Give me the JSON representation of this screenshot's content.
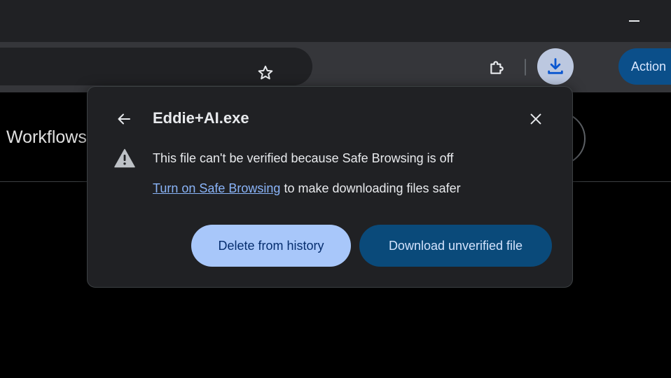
{
  "toolbar": {
    "action_label": "Action"
  },
  "page": {
    "header_text": "Workflows"
  },
  "dialog": {
    "title": "Eddie+AI.exe",
    "warning": "This file can't be verified because Safe Browsing is off",
    "safe_browsing_link": "Turn on Safe Browsing",
    "safe_browsing_suffix": " to make downloading files safer",
    "delete_label": "Delete from history",
    "download_label": "Download unverified file"
  },
  "icons": {
    "minimize": "minimize-icon",
    "star": "star-icon",
    "extensions": "puzzle-icon",
    "download": "download-icon",
    "back": "arrow-left-icon",
    "close": "close-icon",
    "warning": "warning-triangle-icon"
  },
  "colors": {
    "accent_blue": "#a8c7fa",
    "primary_button": "#0a4a7a",
    "link": "#8ab4f8"
  }
}
